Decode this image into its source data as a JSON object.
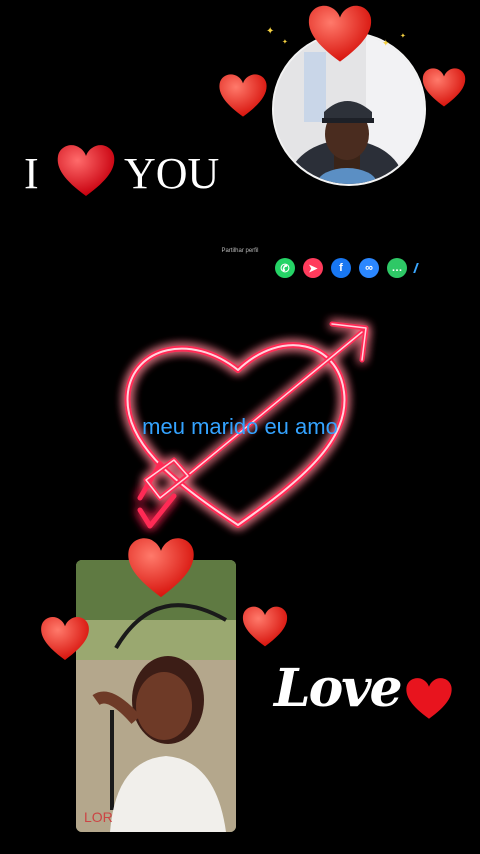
{
  "header": {
    "i_text": "I",
    "you_text": "YOU"
  },
  "share": {
    "label": "Partilhar perfil",
    "buttons": [
      {
        "name": "whatsapp",
        "color": "#25d366",
        "glyph": "✆"
      },
      {
        "name": "send",
        "color": "#ff3b5c",
        "glyph": "➤"
      },
      {
        "name": "facebook",
        "color": "#1877f2",
        "glyph": "f"
      },
      {
        "name": "link",
        "color": "#2b87ff",
        "glyph": "∞"
      },
      {
        "name": "message",
        "color": "#2ec866",
        "glyph": "…"
      }
    ]
  },
  "caption": "meu marido eu amo",
  "love_text": "Love",
  "colors": {
    "neon": "#ff2a55",
    "heart": "#e8141e",
    "caption": "#34a3ff"
  }
}
